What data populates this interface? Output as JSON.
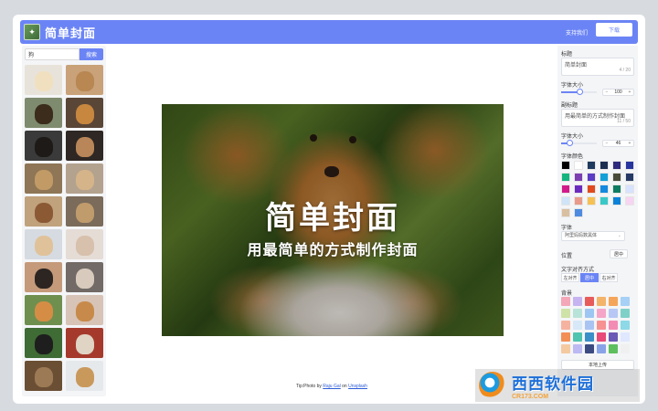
{
  "header": {
    "title": "简单封面",
    "support_label": "支持我们",
    "download_label": "下载"
  },
  "sidebar": {
    "search_value": "狗",
    "search_button": "搜索",
    "thumbs": [
      {
        "bg": "#e8e3da",
        "dog": "#f0e0c0"
      },
      {
        "bg": "#c9a27a",
        "dog": "#b88752"
      },
      {
        "bg": "#7e8b6e",
        "dog": "#3b2c1c"
      },
      {
        "bg": "#5a4637",
        "dog": "#c7873e"
      },
      {
        "bg": "#3a3a3a",
        "dog": "#1e1a17"
      },
      {
        "bg": "#2e2723",
        "dog": "#b98659"
      },
      {
        "bg": "#8e7656",
        "dog": "#c19a66"
      },
      {
        "bg": "#b3a28e",
        "dog": "#d5b48a"
      },
      {
        "bg": "#c0a27d",
        "dog": "#8b5a35"
      },
      {
        "bg": "#7a6b5a",
        "dog": "#c09b6c"
      },
      {
        "bg": "#d6dbe2",
        "dog": "#e0c29a"
      },
      {
        "bg": "#e5dcd6",
        "dog": "#d7c0ac"
      },
      {
        "bg": "#c59a7a",
        "dog": "#2c2522"
      },
      {
        "bg": "#726a66",
        "dog": "#d8cbbd"
      },
      {
        "bg": "#6f8f4f",
        "dog": "#d58d45"
      },
      {
        "bg": "#d7c4b7",
        "dog": "#c88a4a"
      },
      {
        "bg": "#3f6b35",
        "dog": "#1e1e1e"
      },
      {
        "bg": "#a53a2c",
        "dog": "#e0d4c4"
      },
      {
        "bg": "#6b4f34",
        "dog": "#9c7a55"
      },
      {
        "bg": "#e6e9ec",
        "dog": "#c9995c"
      }
    ]
  },
  "cover": {
    "title": "简单封面",
    "subtitle": "用最简单的方式制作封面"
  },
  "credit": {
    "prefix": "Tip:Photo by",
    "author": "Raju Gal",
    "middle": "on",
    "source": "Unsplash"
  },
  "panel": {
    "title_label": "标题",
    "title_value": "简单封面",
    "title_count": "4 / 20",
    "title_size_label": "字体大小",
    "title_size_value": "100",
    "title_size_fraction": 0.5,
    "subtitle_label": "副标题",
    "subtitle_value": "用最简单的方式制作封面",
    "subtitle_count": "11 / 50",
    "subtitle_size_label": "字体大小",
    "subtitle_size_value": "46",
    "subtitle_size_fraction": 0.23,
    "font_color_label": "字体颜色",
    "font_colors": [
      "#000000",
      "#ffffff",
      "#1e3a5f",
      "#1c2d4f",
      "#2e2a7e",
      "#27359e",
      "#14b57f",
      "#7b3fb2",
      "#5b3cc4",
      "#12a0d8",
      "#4b4b3a",
      "#273a66",
      "#d31a8a",
      "#6c2bbf",
      "#e04a1e",
      "#1489e0",
      "#0d7c62",
      "#d7e2ff",
      "#cfe4f8",
      "#e99a8a",
      "#f5c155",
      "#39c8c8",
      "#0b82d8",
      "#f7d5f2",
      "#d9c0a0",
      "#4e8be0"
    ],
    "font_label": "字体",
    "font_value": "阿里妈妈数黑体",
    "position_label": "位置",
    "position_value": "居中",
    "align_label": "文字对齐方式",
    "align_options": [
      "左对齐",
      "居中",
      "右对齐"
    ],
    "align_selected": "居中",
    "background_label": "背景",
    "bg_swatches": [
      "#f4a7b9",
      "#c6b4f0",
      "#e85b5b",
      "#f3b46a",
      "#f5a55a",
      "#a6d0f5",
      "#cfe2a8",
      "#b8e3d8",
      "#9ec6f2",
      "#f5a5c8",
      "#b8c8f5",
      "#7fd1c8",
      "#f6b2a0",
      "#d7e8f8",
      "#a9c4f3",
      "#f79292",
      "#f38cb4",
      "#8dd9e7",
      "#f28f56",
      "#4fc4b0",
      "#3a8fc8",
      "#e84a7a",
      "#6a5ab5",
      "#dfe8ff",
      "#f5c9a0",
      "#bdb9f2",
      "#3b4b82",
      "#89a3e8",
      "#5fbf5f",
      "#f0f0f0"
    ],
    "upload_label": "本地上传"
  },
  "watermark": {
    "main": "西西软件园",
    "sub": "CR173.COM"
  }
}
